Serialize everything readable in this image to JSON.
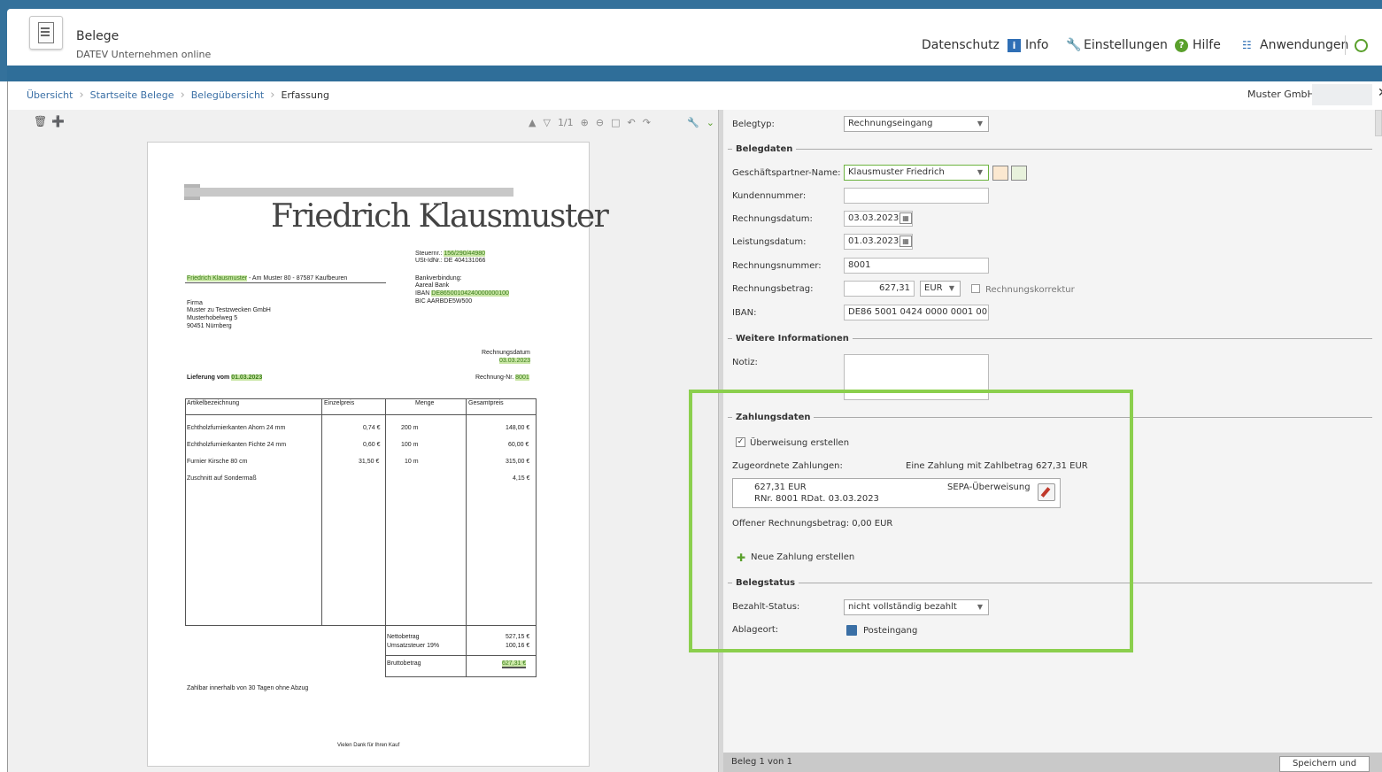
{
  "app": {
    "title": "Belege",
    "subtitle": "DATEV Unternehmen online"
  },
  "header_nav": {
    "datenschutz": "Datenschutz",
    "info": "Info",
    "einstellungen": "Einstellungen",
    "hilfe": "Hilfe",
    "anwendungen": "Anwendungen"
  },
  "breadcrumb": {
    "items": [
      "Übersicht",
      "Startseite Belege",
      "Belegübersicht"
    ],
    "current": "Erfassung"
  },
  "company": "Muster GmbH",
  "viewer": {
    "page": "1/1"
  },
  "document": {
    "brand": "Friedrich Klausmuster",
    "tax_no_label": "Steuernr.:",
    "tax_no": "156/290/44980",
    "vat_id": "USt-IdNr.: DE 404131066",
    "sender_name": "Friedrich Klausmuster",
    "sender_addr": " - Am Muster 80 - 87587 Kaufbeuren",
    "bank_label": "Bankverbindung:",
    "bank": "Aareal Bank",
    "iban_label": "IBAN",
    "iban": "DE86500104240000000100",
    "bic": "BIC AARBDE5W500",
    "recipient": [
      "Firma",
      "Muster zu Testzwecken GmbH",
      "Musterhobelweg 5",
      "90451 Nürnberg"
    ],
    "date_label": "Rechnungsdatum",
    "date": "03.03.2023",
    "delivery_label": "Lieferung vom",
    "delivery_date": "01.03.2023",
    "invoice_no_label": "Rechnung-Nr.",
    "invoice_no": "8001",
    "columns": [
      "Artikelbezeichnung",
      "Einzelpreis",
      "Menge",
      "Gesamtpreis"
    ],
    "rows": [
      {
        "name": "Echtholzfurnierkanten Ahorn 24 mm",
        "price": "0,74 €",
        "qty": "200 m",
        "total": "148,00 €"
      },
      {
        "name": "Echtholzfurnierkanten Fichte 24 mm",
        "price": "0,60 €",
        "qty": "100 m",
        "total": "60,00 €"
      },
      {
        "name": "Furnier Kirsche 80 cm",
        "price": "31,50 €",
        "qty": "10 m",
        "total": "315,00 €"
      },
      {
        "name": "Zuschnitt auf Sondermaß",
        "price": "",
        "qty": "",
        "total": "4,15 €"
      }
    ],
    "net_label": "Nettobetrag",
    "net": "527,15 €",
    "vat_label": "Umsatzsteuer 19%",
    "vat": "100,16 €",
    "gross_label": "Bruttobetrag",
    "gross": "627,31 €",
    "payment_terms": "Zahlbar innerhalb von 30 Tagen ohne Abzug",
    "thanks": "Vielen Dank für Ihren Kauf"
  },
  "form": {
    "belegtyp_label": "Belegtyp:",
    "belegtyp": "Rechnungseingang",
    "section_belegdaten": "Belegdaten",
    "partner_label": "Geschäftspartner-Name:",
    "partner": "Klausmuster Friedrich",
    "kunden_label": "Kundennummer:",
    "kunden": "",
    "rdatum_label": "Rechnungsdatum:",
    "rdatum": "03.03.2023",
    "ldatum_label": "Leistungsdatum:",
    "ldatum": "01.03.2023",
    "rnummer_label": "Rechnungsnummer:",
    "rnummer": "8001",
    "betrag_label": "Rechnungsbetrag:",
    "betrag": "627,31",
    "currency": "EUR",
    "korrektur_label": "Rechnungskorrektur",
    "iban_label": "IBAN:",
    "iban": "DE86 5001 0424 0000 0001 00",
    "section_weitere": "Weitere Informationen",
    "notiz_label": "Notiz:",
    "section_zahlung": "Zahlungsdaten",
    "ueberweisung_label": "Überweisung erstellen",
    "zugeordnet_label": "Zugeordnete Zahlungen:",
    "zugeordnet_summary": "Eine Zahlung mit Zahlbetrag 627,31 EUR",
    "payment_amount": "627,31 EUR",
    "payment_ref": "RNr. 8001 RDat. 03.03.2023",
    "payment_type": "SEPA-Überweisung",
    "offen": "Offener Rechnungsbetrag: 0,00 EUR",
    "neue_zahlung": "Neue Zahlung erstellen",
    "section_status": "Belegstatus",
    "bezahlt_label": "Bezahlt-Status:",
    "bezahlt": "nicht vollständig bezahlt",
    "ablage_label": "Ablageort:",
    "ablage": "Posteingang"
  },
  "footer": {
    "count": "Beleg 1 von 1",
    "save": "Speichern und weiter"
  },
  "colors": {
    "topbar": "#34719b",
    "highlight": "#8bcf4d",
    "link": "#3a6fa5"
  }
}
